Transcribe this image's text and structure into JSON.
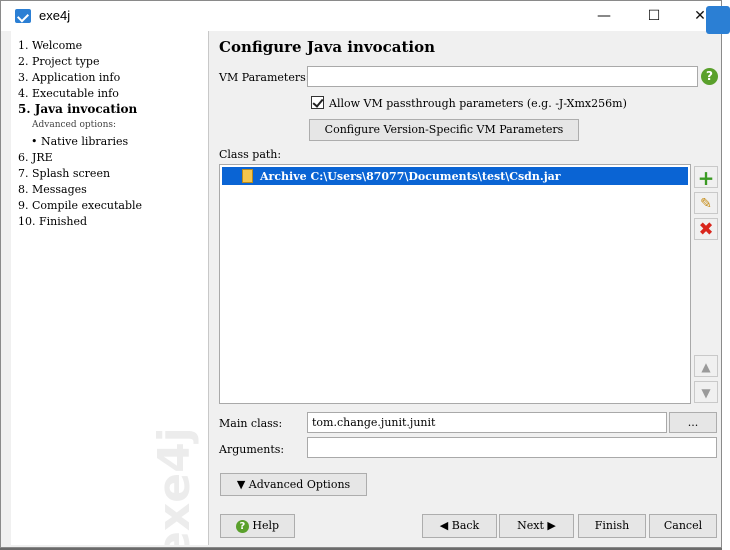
{
  "window": {
    "title": "exe4j",
    "minimize": "—",
    "maximize": "☐",
    "close": "✕"
  },
  "steps": [
    {
      "label": "1.  Welcome"
    },
    {
      "label": "2.  Project type"
    },
    {
      "label": "3.  Application info"
    },
    {
      "label": "4.  Executable info"
    },
    {
      "label": "5.  Java invocation"
    },
    {
      "label": "Advanced options:"
    },
    {
      "label": "• Native libraries"
    },
    {
      "label": "6.  JRE"
    },
    {
      "label": "7.  Splash screen"
    },
    {
      "label": "8.  Messages"
    },
    {
      "label": "9.  Compile executable"
    },
    {
      "label": "10.  Finished"
    }
  ],
  "watermark": "exe4j",
  "page": {
    "title": "Configure Java invocation",
    "vm_label": "VM Parameters:",
    "vm_value": "",
    "allow_passthrough": "Allow VM passthrough parameters (e.g. -J-Xmx256m)",
    "configure_vm_button": "Configure Version-Specific VM Parameters",
    "classpath_label": "Class path:",
    "classpath_entries": [
      {
        "type": "Archive",
        "path": "C:\\Users\\87077\\Documents\\test\\Csdn.jar"
      }
    ],
    "main_class_label": "Main class:",
    "main_class_value": "tom.change.junit.junit",
    "browse_button": "...",
    "arguments_label": "Arguments:",
    "arguments_value": "",
    "advanced_button": "Advanced Options"
  },
  "footer": {
    "help": "Help",
    "back": "Back",
    "next": "Next",
    "finish": "Finish",
    "cancel": "Cancel"
  },
  "colors": {
    "selection": "#0a64d4",
    "accent_green": "#5aa02c",
    "remove_red": "#d9261c"
  }
}
